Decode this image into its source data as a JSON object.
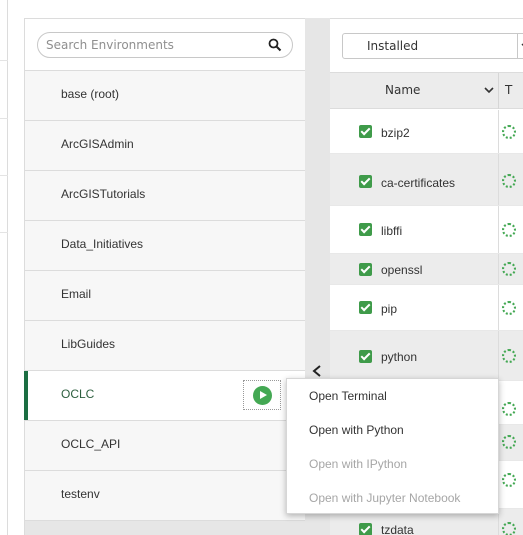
{
  "search": {
    "placeholder": "Search Environments"
  },
  "environments": [
    {
      "label": "base (root)",
      "selected": false
    },
    {
      "label": "ArcGISAdmin",
      "selected": false
    },
    {
      "label": "ArcGISTutorials",
      "selected": false
    },
    {
      "label": "Data_Initiatives",
      "selected": false
    },
    {
      "label": "Email",
      "selected": false
    },
    {
      "label": "LibGuides",
      "selected": false
    },
    {
      "label": "OCLC",
      "selected": true
    },
    {
      "label": "OCLC_API",
      "selected": false
    },
    {
      "label": "testenv",
      "selected": false
    }
  ],
  "filter": {
    "selected": "Installed"
  },
  "table": {
    "name_header": "Name",
    "type_header": "T"
  },
  "packages": [
    {
      "name": "bzip2",
      "checked": true
    },
    {
      "name": "ca-certificates",
      "checked": true
    },
    {
      "name": "libffi",
      "checked": true
    },
    {
      "name": "openssl",
      "checked": true
    },
    {
      "name": "pip",
      "checked": true
    },
    {
      "name": "python",
      "checked": true
    },
    {
      "name": "",
      "checked": false
    },
    {
      "name": "",
      "checked": false
    },
    {
      "name": "",
      "checked": false
    },
    {
      "name": "tzdata",
      "checked": true
    }
  ],
  "context_menu": {
    "items": [
      {
        "label": "Open Terminal",
        "enabled": true
      },
      {
        "label": "Open with Python",
        "enabled": true
      },
      {
        "label": "Open with IPython",
        "enabled": false
      },
      {
        "label": "Open with Jupyter Notebook",
        "enabled": false
      }
    ]
  },
  "colors": {
    "accent_green": "#43a853",
    "selected_bar": "#1b6e42",
    "row_alt": "#ececec"
  }
}
